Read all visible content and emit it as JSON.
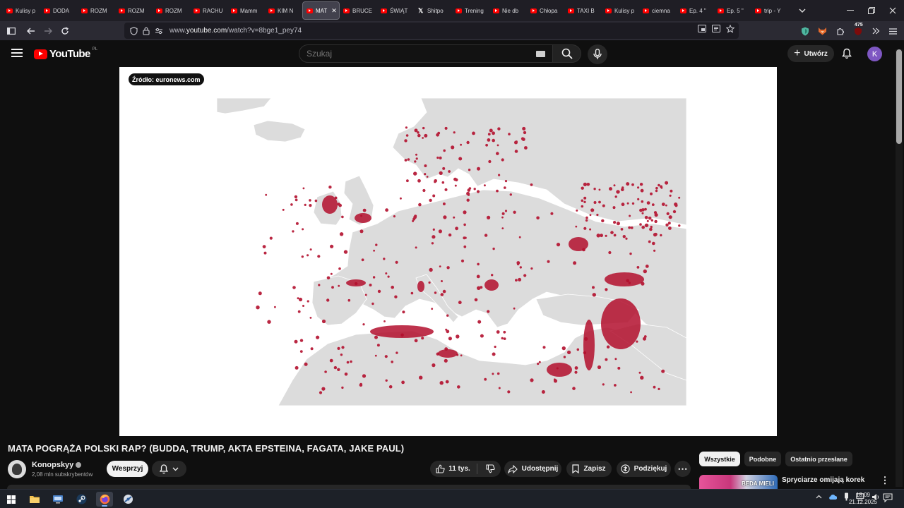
{
  "browser": {
    "tabs": [
      {
        "label": "Kulisy p",
        "icon": "youtube-icon"
      },
      {
        "label": "DODA",
        "icon": "youtube-icon"
      },
      {
        "label": "ROZM",
        "icon": "youtube-icon"
      },
      {
        "label": "ROZM",
        "icon": "youtube-icon"
      },
      {
        "label": "ROZM",
        "icon": "youtube-icon"
      },
      {
        "label": "RACHU",
        "icon": "youtube-icon"
      },
      {
        "label": "Mamm",
        "icon": "youtube-icon"
      },
      {
        "label": "KIM N",
        "icon": "youtube-icon"
      },
      {
        "label": "MAT",
        "icon": "youtube-icon",
        "active": true
      },
      {
        "label": "BRUCE",
        "icon": "youtube-icon"
      },
      {
        "label": "ŚWIĄT",
        "icon": "youtube-icon"
      },
      {
        "label": "Shitpo",
        "icon": "x-icon"
      },
      {
        "label": "Trening",
        "icon": "youtube-icon"
      },
      {
        "label": "Nie db",
        "icon": "youtube-icon"
      },
      {
        "label": "Chłopa",
        "icon": "youtube-icon"
      },
      {
        "label": "TAXI B",
        "icon": "youtube-icon"
      },
      {
        "label": "Kulisy p",
        "icon": "youtube-icon"
      },
      {
        "label": "ciemna",
        "icon": "youtube-icon"
      },
      {
        "label": "Ep. 4 \"",
        "icon": "youtube-icon"
      },
      {
        "label": "Ep. 5 \"",
        "icon": "youtube-icon"
      },
      {
        "label": "trip - Y",
        "icon": "youtube-icon"
      }
    ],
    "url_prefix": "www.",
    "url_domain": "youtube.com",
    "url_path": "/watch?v=8bge1_pey74",
    "extension_badge": "475"
  },
  "youtube": {
    "logo_text": "YouTube",
    "logo_country": "PL",
    "search_placeholder": "Szukaj",
    "create_label": "Utwórz",
    "avatar_letter": "K",
    "accent_color": "#ff0000"
  },
  "video": {
    "source_badge": "Źródło: euronews.com",
    "title": "MATA POGRĄŻA POLSKI RAP? (BUDDA, TRUMP, AKTA EPSTEINA, FAGATA, JAKE PAUL)",
    "channel_name": "Konopskyy",
    "subscribers": "2,08 mln subskrybentów",
    "support_label": "Wesprzyj",
    "likes": "11 tys.",
    "share_label": "Udostępnij",
    "save_label": "Zapisz",
    "thanks_label": "Podziękuj"
  },
  "sidebar": {
    "chips": [
      "Wszystkie",
      "Podobne",
      "Ostatnio przesłane"
    ],
    "recommendation": {
      "title": "Spryciarze omijają korek",
      "thumb_text": "BEDA MIELI"
    }
  },
  "taskbar": {
    "time": "18:09",
    "date": "21.12.2025"
  }
}
